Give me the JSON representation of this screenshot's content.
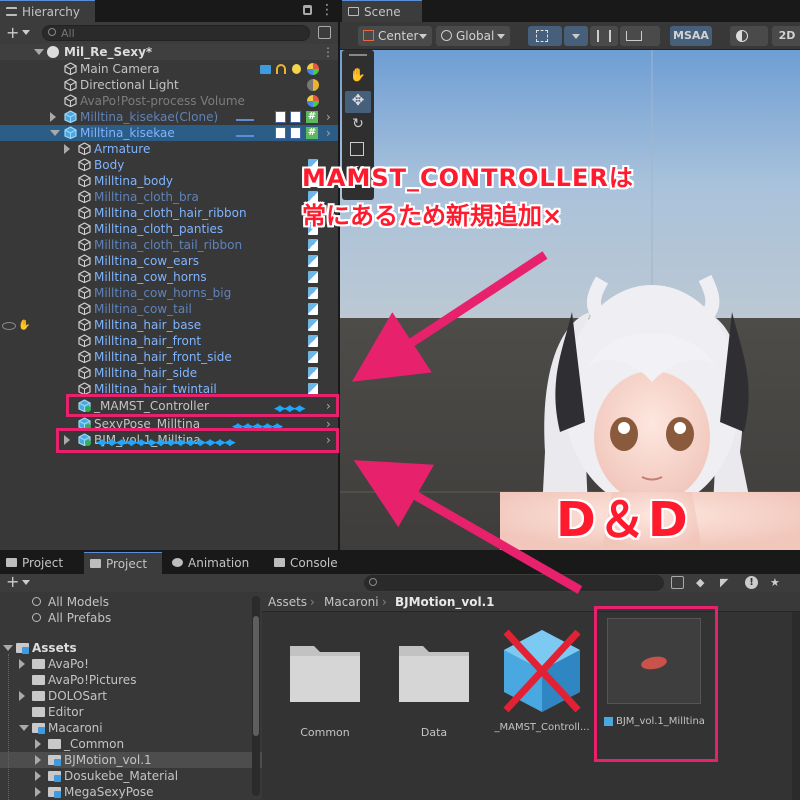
{
  "hierarchy": {
    "tab": "Hierarchy",
    "search_placeholder": "All",
    "scene_name": "Mil_Re_Sexy*",
    "rows": [
      {
        "label": "Main Camera"
      },
      {
        "label": "Directional Light"
      },
      {
        "label": "AvaPo!Post-process Volume"
      },
      {
        "label": "Milltina_kisekae(Clone)"
      },
      {
        "label": "Milltina_kisekae"
      },
      {
        "label": "Armature"
      },
      {
        "label": "Body"
      },
      {
        "label": "Milltina_body"
      },
      {
        "label": "Milltina_cloth_bra"
      },
      {
        "label": "Milltina_cloth_hair_ribbon"
      },
      {
        "label": "Milltina_cloth_panties"
      },
      {
        "label": "Milltina_cloth_tail_ribbon"
      },
      {
        "label": "Milltina_cow_ears"
      },
      {
        "label": "Milltina_cow_horns"
      },
      {
        "label": "Milltina_cow_horns_big"
      },
      {
        "label": "Milltina_cow_tail"
      },
      {
        "label": "Milltina_hair_base"
      },
      {
        "label": "Milltina_hair_front"
      },
      {
        "label": "Milltina_hair_front_side"
      },
      {
        "label": "Milltina_hair_side"
      },
      {
        "label": "Milltina_hair_twintail"
      },
      {
        "label": "_MAMST_Controller"
      },
      {
        "label": "SexyPose_Milltina"
      },
      {
        "label": "BJM_vol.1_Milltina"
      }
    ]
  },
  "scene": {
    "tab": "Scene",
    "pivot": "Center",
    "space": "Global",
    "msaa": "MSAA",
    "mode2d": "2D"
  },
  "annotations": {
    "note_line1": "MAMST_CONTROLLERは",
    "note_line2": "常にあるため新規追加×",
    "dd": "D＆D"
  },
  "bottom_tabs": [
    "Project",
    "Project",
    "Animation",
    "Console"
  ],
  "project": {
    "left": [
      {
        "label": "All Models"
      },
      {
        "label": "All Prefabs"
      },
      {
        "label": "Assets"
      },
      {
        "label": "AvaPo!"
      },
      {
        "label": "AvaPo!Pictures"
      },
      {
        "label": "DOLOSart"
      },
      {
        "label": "Editor"
      },
      {
        "label": "Macaroni"
      },
      {
        "label": "_Common"
      },
      {
        "label": "BJMotion_vol.1"
      },
      {
        "label": "Dosukebe_Material"
      },
      {
        "label": "MegaSexyPose"
      }
    ],
    "breadcrumb": [
      "Assets",
      "Macaroni",
      "BJMotion_vol.1"
    ],
    "assets": [
      {
        "label": "Common"
      },
      {
        "label": "Data"
      },
      {
        "label": "_MAMST_Controll..."
      },
      {
        "label": "BJM_vol.1_Milltina"
      }
    ]
  },
  "colors": {
    "accent_pink": "#e8216c",
    "annotation_red": "#ff1b2d",
    "selection_blue": "#2c5d87",
    "prefab_blue": "#7fb4ff"
  }
}
